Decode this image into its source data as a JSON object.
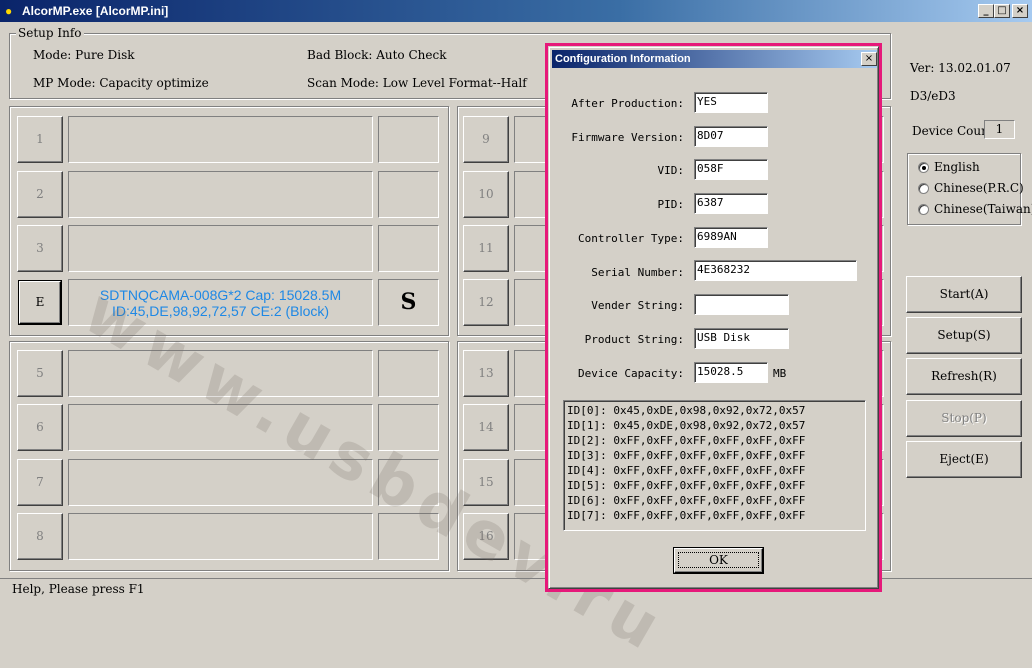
{
  "window": {
    "title": "AlcorMP.exe [AlcorMP.ini]",
    "min": "_",
    "max": "□",
    "close": "×"
  },
  "setup": {
    "legend": "Setup Info",
    "mode": "Mode: Pure Disk",
    "bad_block": "Bad Block: Auto Check",
    "mp_mode": "MP Mode: Capacity optimize",
    "scan_mode": "Scan Mode: Low Level Format--Half"
  },
  "ports": {
    "left": [
      {
        "label": "1",
        "info1": "",
        "info2": "",
        "status": ""
      },
      {
        "label": "2",
        "info1": "",
        "info2": "",
        "status": ""
      },
      {
        "label": "3",
        "info1": "",
        "info2": "",
        "status": ""
      },
      {
        "label": "E",
        "info1": "SDTNQCAMA-008G*2 Cap: 15028.5M",
        "info2": "ID:45,DE,98,92,72,57 CE:2 (Block)",
        "status": "S"
      },
      {
        "label": "5",
        "info1": "",
        "info2": "",
        "status": ""
      },
      {
        "label": "6",
        "info1": "",
        "info2": "",
        "status": ""
      },
      {
        "label": "7",
        "info1": "",
        "info2": "",
        "status": ""
      },
      {
        "label": "8",
        "info1": "",
        "info2": "",
        "status": ""
      }
    ],
    "right": [
      {
        "label": "9"
      },
      {
        "label": "10"
      },
      {
        "label": "11"
      },
      {
        "label": "12"
      },
      {
        "label": "13"
      },
      {
        "label": "14"
      },
      {
        "label": "15"
      },
      {
        "label": "16"
      }
    ]
  },
  "side": {
    "version": "Ver: 13.02.01.07",
    "chip": "D3/eD3",
    "device_count_label": "Device Count:",
    "device_count": "1",
    "languages": [
      {
        "label": "English",
        "checked": true
      },
      {
        "label": "Chinese(P.R.C)",
        "checked": false
      },
      {
        "label": "Chinese(Taiwan)",
        "checked": false
      }
    ],
    "buttons": {
      "start": "Start(A)",
      "setup": "Setup(S)",
      "refresh": "Refresh(R)",
      "stop": "Stop(P)",
      "eject": "Eject(E)"
    }
  },
  "status_bar": "Help, Please press F1",
  "watermark": "www.usbdev.ru",
  "dialog": {
    "title": "Configuration Information",
    "close": "×",
    "after_production_label": "After Production:",
    "after_production": "YES",
    "firmware_label": "Firmware Version:",
    "firmware": "8D07",
    "vid_label": "VID:",
    "vid": "058F",
    "pid_label": "PID:",
    "pid": "6387",
    "controller_label": "Controller Type:",
    "controller": "6989AN",
    "serial_label": "Serial Number:",
    "serial": "4E368232",
    "vender_label": "Vender String:",
    "vender": "",
    "product_label": "Product String:",
    "product": "USB Disk",
    "capacity_label": "Device Capacity:",
    "capacity": "15028.5",
    "capacity_unit": "MB",
    "ids": [
      "ID[0]: 0x45,0xDE,0x98,0x92,0x72,0x57",
      "ID[1]: 0x45,0xDE,0x98,0x92,0x72,0x57",
      "ID[2]: 0xFF,0xFF,0xFF,0xFF,0xFF,0xFF",
      "ID[3]: 0xFF,0xFF,0xFF,0xFF,0xFF,0xFF",
      "ID[4]: 0xFF,0xFF,0xFF,0xFF,0xFF,0xFF",
      "ID[5]: 0xFF,0xFF,0xFF,0xFF,0xFF,0xFF",
      "ID[6]: 0xFF,0xFF,0xFF,0xFF,0xFF,0xFF",
      "ID[7]: 0xFF,0xFF,0xFF,0xFF,0xFF,0xFF"
    ],
    "ok": "OK"
  },
  "colors": {
    "highlight": "#e6197a",
    "device_text": "#1e88e5",
    "title_bar": "#0a246a"
  }
}
